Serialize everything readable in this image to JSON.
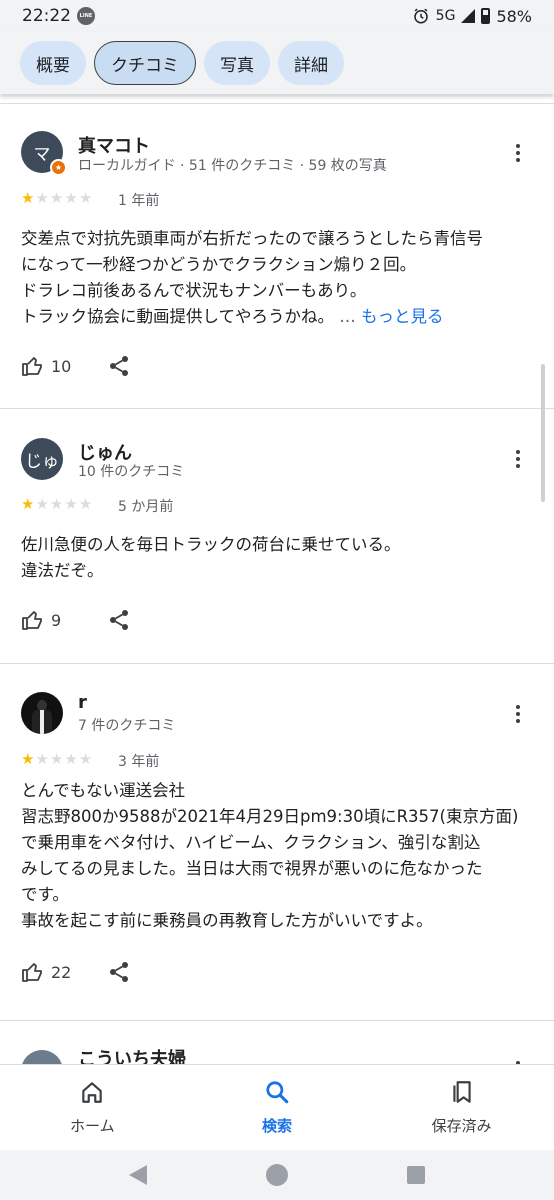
{
  "status_bar": {
    "time": "22:22",
    "app_badge": "LINE",
    "network": "5G",
    "battery": "58%"
  },
  "tabs": [
    {
      "label": "概要",
      "active": false
    },
    {
      "label": "クチコミ",
      "active": true
    },
    {
      "label": "写真",
      "active": false
    },
    {
      "label": "詳細",
      "active": false
    }
  ],
  "reviews": [
    {
      "avatar_initial": "マ",
      "name": "真マコト",
      "meta": "ローカルガイド · 51 件のクチコミ · 59 枚の写真",
      "rating": 1,
      "date": "1 年前",
      "text": "交差点で対抗先頭車両が右折だったので譲ろうとしたら青信号\nになって一秒経つかどうかでクラクション煽り２回。\nドラレコ前後あるんで状況もナンバーもあり。\nトラック協会に動画提供してやろうかね。",
      "ellipsis": "…",
      "more_label": "もっと見る",
      "likes": "10"
    },
    {
      "avatar_initial": "じゅ",
      "name": "じゅん",
      "meta": "10 件のクチコミ",
      "rating": 1,
      "date": "5 か月前",
      "text": "佐川急便の人を毎日トラックの荷台に乗せている。\n違法だぞ。",
      "likes": "9"
    },
    {
      "avatar_initial": "",
      "name": "r",
      "meta": "7 件のクチコミ",
      "rating": 1,
      "date": "3 年前",
      "text": "とんでもない運送会社\n習志野800か9588が2021年4月29日pm9:30頃にR357(東京方面)\nで乗用車をベタ付け、ハイビーム、クラクション、強引な割込\nみしてるの見ました。当日は大雨で視界が悪いのに危なかった\nです。\n事故を起こす前に乗務員の再教育した方がいいですよ。",
      "likes": "22"
    },
    {
      "avatar_initial": "",
      "name": "こういち夫婦",
      "meta": "",
      "rating": 0,
      "date": "",
      "text": "",
      "likes": ""
    }
  ],
  "bottom_nav": [
    {
      "label": "ホーム",
      "icon": "home-icon",
      "active": false
    },
    {
      "label": "検索",
      "icon": "search-icon",
      "active": true
    },
    {
      "label": "保存済み",
      "icon": "saved-icon",
      "active": false
    }
  ],
  "colors": {
    "accent": "#1a73e8",
    "star": "#fbbc04",
    "chip": "#d5e5f7",
    "local_guide_badge": "#e8710a"
  }
}
